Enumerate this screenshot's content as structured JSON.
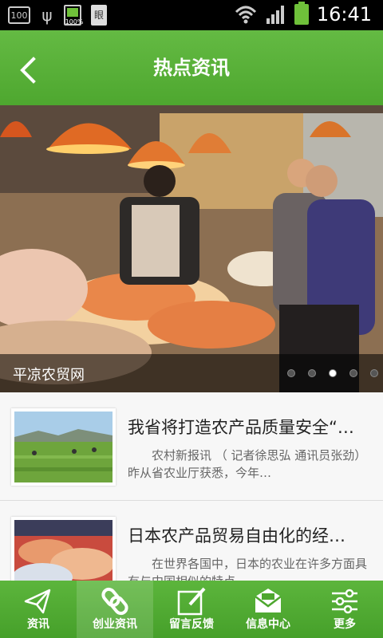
{
  "status_bar": {
    "box_label": "100",
    "battery_small_pct": "100%",
    "doc_label": "眼",
    "time": "16:41"
  },
  "header": {
    "title": "热点资讯"
  },
  "banner": {
    "caption": "平凉农贸网",
    "slide_count": 5,
    "active_index": 2
  },
  "news": [
    {
      "title": "我省将打造农产品质量安全“…",
      "desc": "农村新报讯 （ 记者徐思弘 通讯员张劲）昨从省农业厅获悉，今年…"
    },
    {
      "title": "日本农产品贸易自由化的经…",
      "desc": "在世界各国中，日本的农业在许多方面具有与中国相似的特点"
    }
  ],
  "tabs": [
    {
      "label": "资讯",
      "icon": "paper-plane-icon"
    },
    {
      "label": "创业资讯",
      "icon": "link-icon",
      "active": true
    },
    {
      "label": "留言反馈",
      "icon": "edit-icon"
    },
    {
      "label": "信息中心",
      "icon": "mail-icon"
    },
    {
      "label": "更多",
      "icon": "sliders-icon"
    }
  ],
  "colors": {
    "brand_green": "#55ad35",
    "status_bar": "#000000"
  }
}
